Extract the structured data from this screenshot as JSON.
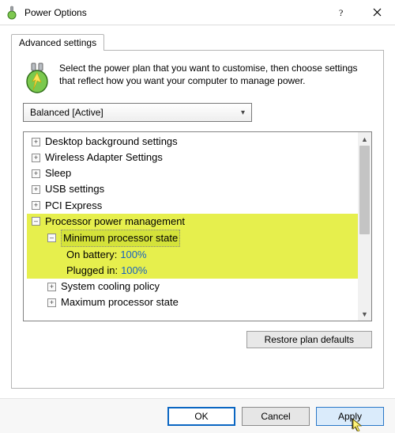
{
  "window": {
    "title": "Power Options"
  },
  "tab": {
    "label": "Advanced settings"
  },
  "intro": "Select the power plan that you want to customise, then choose settings that reflect how you want your computer to manage power.",
  "plan": {
    "selected": "Balanced [Active]"
  },
  "tree": {
    "items": [
      {
        "label": "Desktop background settings"
      },
      {
        "label": "Wireless Adapter Settings"
      },
      {
        "label": "Sleep"
      },
      {
        "label": "USB settings"
      },
      {
        "label": "PCI Express"
      }
    ],
    "ppm": {
      "label": "Processor power management",
      "min": {
        "label": "Minimum processor state",
        "battery_label": "On battery:",
        "battery_value": "100%",
        "plugged_label": "Plugged in:",
        "plugged_value": "100%"
      },
      "cooling": {
        "label": "System cooling policy"
      },
      "max": {
        "label": "Maximum processor state"
      }
    }
  },
  "buttons": {
    "restore": "Restore plan defaults",
    "ok": "OK",
    "cancel": "Cancel",
    "apply": "Apply"
  }
}
